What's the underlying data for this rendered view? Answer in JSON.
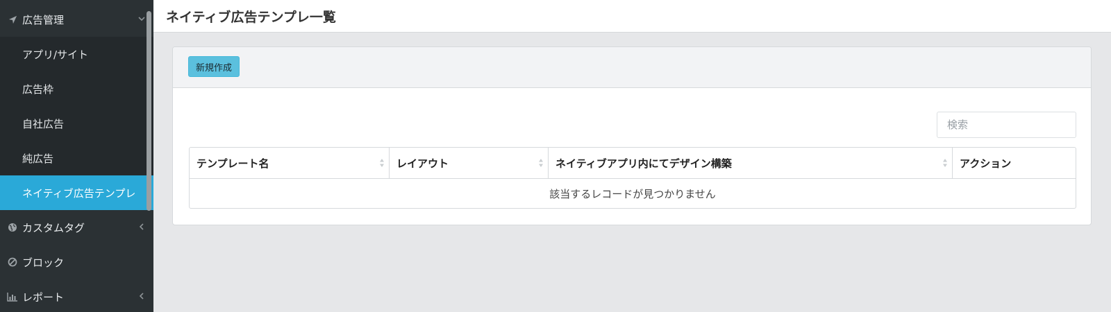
{
  "sidebar": {
    "items": [
      {
        "label": "広告管理",
        "icon": "location-arrow-icon",
        "level": "top",
        "chevron": "down"
      },
      {
        "label": "アプリ/サイト",
        "level": "sub"
      },
      {
        "label": "広告枠",
        "level": "sub"
      },
      {
        "label": "自社広告",
        "level": "sub"
      },
      {
        "label": "純広告",
        "level": "sub"
      },
      {
        "label": "ネイティブ広告テンプレ",
        "level": "sub",
        "active": true
      },
      {
        "label": "カスタムタグ",
        "icon": "globe-icon",
        "level": "top",
        "chevron": "left"
      },
      {
        "label": "ブロック",
        "icon": "ban-icon",
        "level": "top"
      },
      {
        "label": "レポート",
        "icon": "bar-chart-icon",
        "level": "top",
        "chevron": "left"
      }
    ]
  },
  "header": {
    "title": "ネイティブ広告テンプレ一覧"
  },
  "panel": {
    "new_button": "新規作成",
    "search_placeholder": "検索",
    "table": {
      "columns": [
        "テンプレート名",
        "レイアウト",
        "ネイティブアプリ内にてデザイン構築",
        "アクション"
      ],
      "empty_message": "該当するレコードが見つかりません"
    }
  },
  "colors": {
    "sidebar_bg": "#2b3134",
    "active_bg": "#2aa9d8",
    "button_bg": "#5bc0de"
  }
}
